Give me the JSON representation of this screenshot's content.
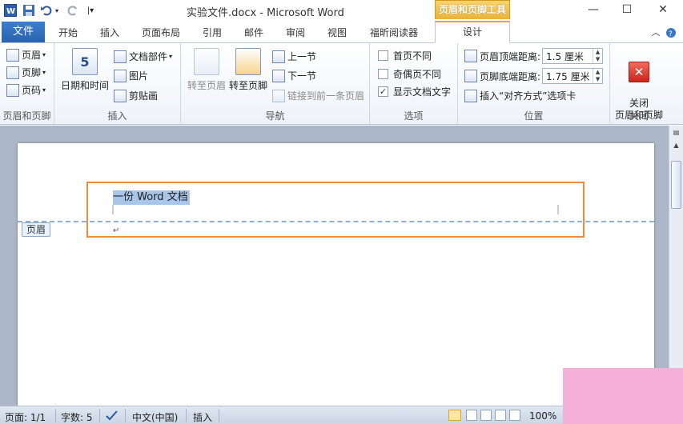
{
  "window": {
    "title": "实验文件.docx - Microsoft Word",
    "context_tool": "页眉和页脚工具",
    "buttons": {
      "minimize": "—",
      "maximize": "☐",
      "close": "✕"
    }
  },
  "tabs": [
    {
      "label": "文件"
    },
    {
      "label": "开始"
    },
    {
      "label": "插入"
    },
    {
      "label": "页面布局"
    },
    {
      "label": "引用"
    },
    {
      "label": "邮件"
    },
    {
      "label": "审阅"
    },
    {
      "label": "视图"
    },
    {
      "label": "福昕阅读器"
    },
    {
      "label": "设计"
    }
  ],
  "ribbon": {
    "hf_group": {
      "label": "页眉和页脚",
      "header": "页眉",
      "footer": "页脚",
      "pagenum": "页码"
    },
    "insert_group": {
      "label": "插入",
      "datetime": "日期和时间",
      "docparts": "文档部件",
      "picture": "图片",
      "clipart": "剪贴画"
    },
    "nav_group": {
      "label": "导航",
      "goto_header": "转至页眉",
      "goto_footer": "转至页脚",
      "prev": "上一节",
      "next": "下一节",
      "link_prev": "链接到前一条页眉"
    },
    "options_group": {
      "label": "选项",
      "first_page": "首页不同",
      "odd_even": "奇偶页不同",
      "show_text": "显示文档文字",
      "show_text_checked": true
    },
    "position_group": {
      "label": "位置",
      "header_top_label": "页眉顶端距离:",
      "header_top_value": "1.5 厘米",
      "footer_bottom_label": "页脚底端距离:",
      "footer_bottom_value": "1.75 厘米",
      "insert_align": "插入“对齐方式”选项卡"
    },
    "close_group": {
      "label": "关闭",
      "close_btn": "关闭\n页眉和页脚"
    }
  },
  "document": {
    "header_text": "一份 Word 文档",
    "header_tag": "页眉",
    "para_mark": "↵"
  },
  "status": {
    "page": "页面: 1/1",
    "words": "字数: 5",
    "language": "中文(中国)",
    "mode": "插入",
    "zoom": "100%"
  },
  "colors": {
    "accent": "#2a62ad",
    "highlight_box": "#ed8b3a",
    "context_tab": "#e9b33b"
  }
}
